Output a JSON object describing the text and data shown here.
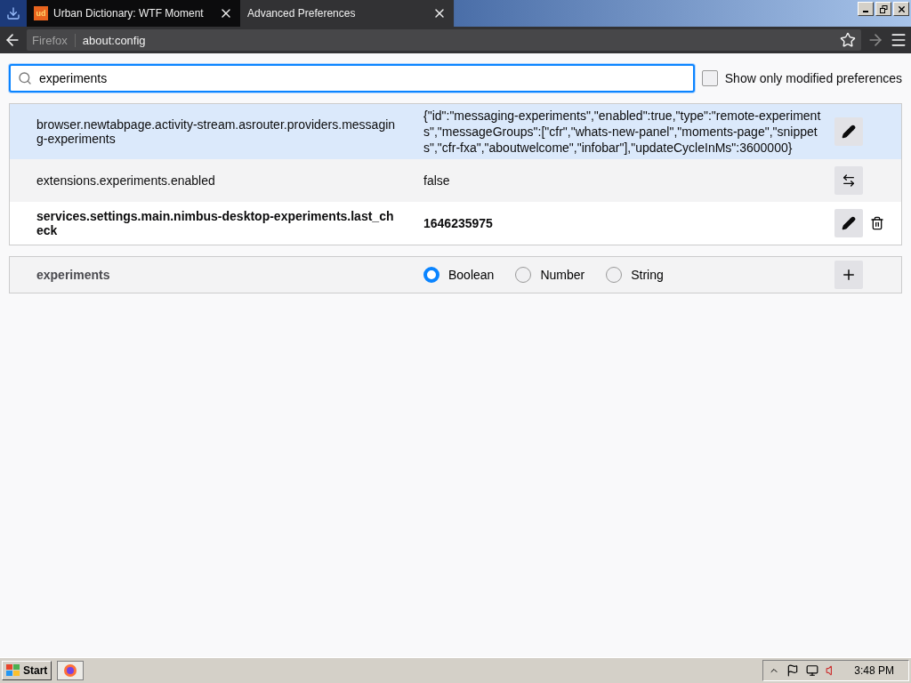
{
  "tabs": [
    {
      "label": "Urban Dictionary: WTF Moment",
      "favicon": "ud",
      "selected": false
    },
    {
      "label": "Advanced Preferences",
      "selected": true
    }
  ],
  "toolbar": {
    "identity": "Firefox",
    "url": "about:config"
  },
  "search": {
    "value": "experiments"
  },
  "show_modified": {
    "label": "Show only modified preferences",
    "checked": false
  },
  "prefs": [
    {
      "name": "browser.newtabpage.activity-stream.asrouter.providers.messaging-experiments",
      "value": "{\"id\":\"messaging-experiments\",\"enabled\":true,\"type\":\"remote-experiments\",\"messageGroups\":[\"cfr\",\"whats-new-panel\",\"moments-page\",\"snippets\",\"cfr-fxa\",\"aboutwelcome\",\"infobar\"],\"updateCycleInMs\":3600000}",
      "kind": "string",
      "modified": false,
      "selected": true
    },
    {
      "name": "extensions.experiments.enabled",
      "value": "false",
      "kind": "boolean",
      "modified": false,
      "selected": false
    },
    {
      "name": "services.settings.main.nimbus-desktop-experiments.last_check",
      "value": "1646235975",
      "kind": "number",
      "modified": true,
      "selected": false
    }
  ],
  "add_row": {
    "name": "experiments",
    "types": [
      {
        "label": "Boolean",
        "selected": true
      },
      {
        "label": "Number",
        "selected": false
      },
      {
        "label": "String",
        "selected": false
      }
    ]
  },
  "taskbar": {
    "start": "Start",
    "clock": "3:48 PM"
  }
}
